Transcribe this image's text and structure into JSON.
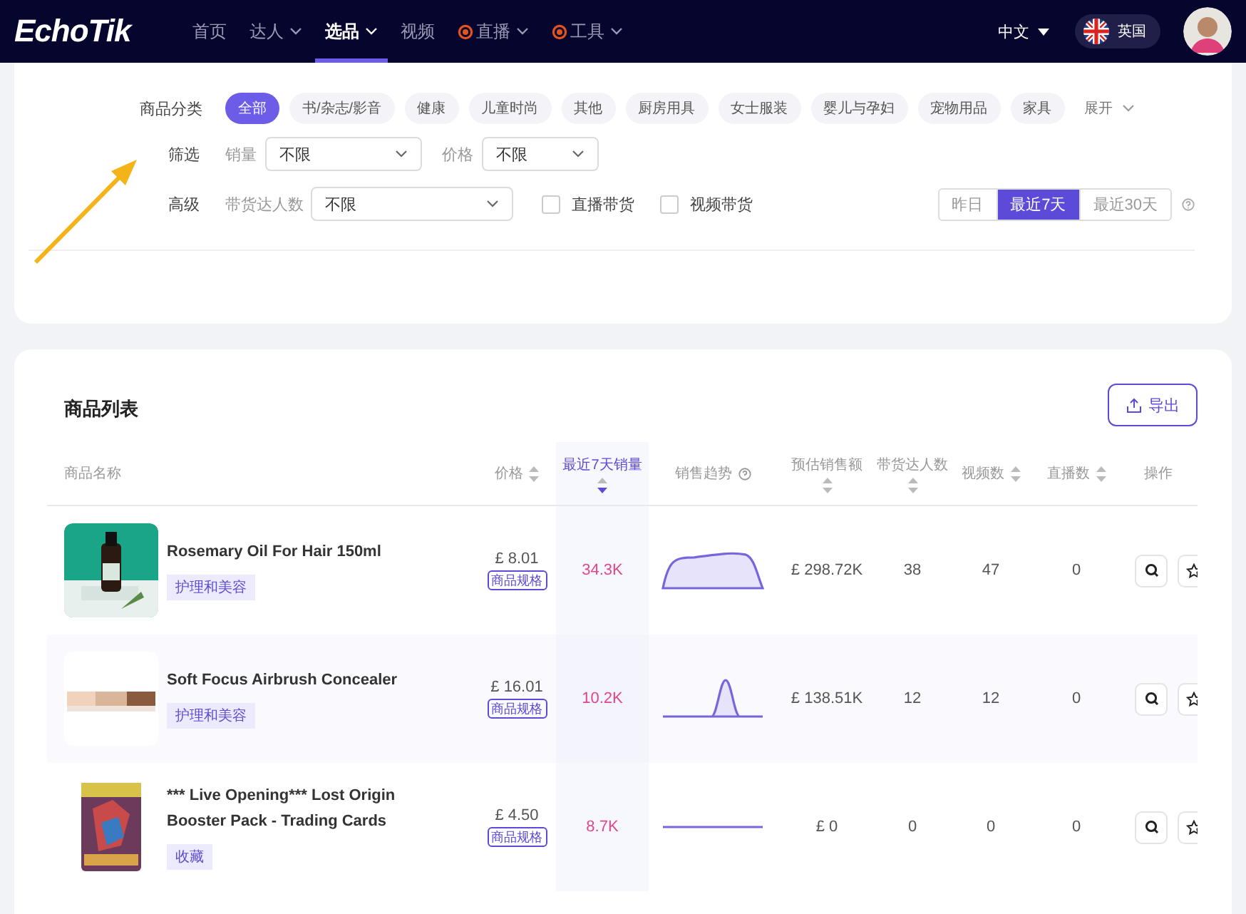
{
  "header": {
    "logo": "EchoTik",
    "nav": [
      {
        "label": "首页",
        "selected": false,
        "dropdown": false,
        "live": false
      },
      {
        "label": "达人",
        "selected": false,
        "dropdown": true,
        "live": false
      },
      {
        "label": "选品",
        "selected": true,
        "dropdown": true,
        "live": false
      },
      {
        "label": "视频",
        "selected": false,
        "dropdown": false,
        "live": false
      },
      {
        "label": "直播",
        "selected": false,
        "dropdown": true,
        "live": true
      },
      {
        "label": "工具",
        "selected": false,
        "dropdown": true,
        "live": true
      }
    ],
    "language": "中文",
    "region": "英国"
  },
  "filters": {
    "category_label": "商品分类",
    "categories": [
      {
        "label": "全部",
        "selected": true
      },
      {
        "label": "书/杂志/影音",
        "selected": false
      },
      {
        "label": "健康",
        "selected": false
      },
      {
        "label": "儿童时尚",
        "selected": false
      },
      {
        "label": "其他",
        "selected": false
      },
      {
        "label": "厨房用具",
        "selected": false
      },
      {
        "label": "女士服装",
        "selected": false
      },
      {
        "label": "婴儿与孕妇",
        "selected": false
      },
      {
        "label": "宠物用品",
        "selected": false
      },
      {
        "label": "家具",
        "selected": false
      }
    ],
    "expand": "展开",
    "screen_label": "筛选",
    "sales_label": "销量",
    "sales_value": "不限",
    "price_label": "价格",
    "price_value": "不限",
    "advanced_label": "高级",
    "creators_label": "带货达人数",
    "creators_value": "不限",
    "checkboxes": [
      {
        "label": "直播带货",
        "checked": false
      },
      {
        "label": "视频带货",
        "checked": false
      }
    ],
    "ranges": [
      {
        "label": "昨日",
        "selected": false
      },
      {
        "label": "最近7天",
        "selected": true
      },
      {
        "label": "最近30天",
        "selected": false
      }
    ]
  },
  "products": {
    "title": "商品列表",
    "export": "导出",
    "columns": [
      {
        "label": "商品名称",
        "sortable": false,
        "selected": false,
        "help": false
      },
      {
        "label": "价格",
        "sortable": true,
        "selected": false,
        "help": false
      },
      {
        "label": "最近7天销量",
        "sortable": true,
        "selected": true,
        "help": false
      },
      {
        "label": "销售趋势",
        "sortable": false,
        "selected": false,
        "help": true
      },
      {
        "label": "预估销售额",
        "sortable": true,
        "selected": false,
        "help": false
      },
      {
        "label": "带货达人数",
        "sortable": true,
        "selected": false,
        "help": false
      },
      {
        "label": "视频数",
        "sortable": true,
        "selected": false,
        "help": false
      },
      {
        "label": "直播数",
        "sortable": true,
        "selected": false,
        "help": false
      },
      {
        "label": "操作",
        "sortable": false,
        "selected": false,
        "help": false
      }
    ],
    "rows": [
      {
        "name": "Rosemary Oil For Hair 150ml",
        "tag": "护理和美容",
        "price": "£ 8.01",
        "spec": "商品规格",
        "sales": "34.3K",
        "revenue": "£ 298.72K",
        "creators": "38",
        "videos": "47",
        "lives": "0"
      },
      {
        "name": "Soft Focus Airbrush Concealer",
        "tag": "护理和美容",
        "price": "£ 16.01",
        "spec": "商品规格",
        "sales": "10.2K",
        "revenue": "£ 138.51K",
        "creators": "12",
        "videos": "12",
        "lives": "0"
      },
      {
        "name": "*** Live Opening*** Lost Origin Booster Pack - Trading Cards",
        "tag": "收藏",
        "price": "£ 4.50",
        "spec": "商品规格",
        "sales": "8.7K",
        "revenue": "£ 0",
        "creators": "0",
        "videos": "0",
        "lives": "0"
      }
    ]
  }
}
